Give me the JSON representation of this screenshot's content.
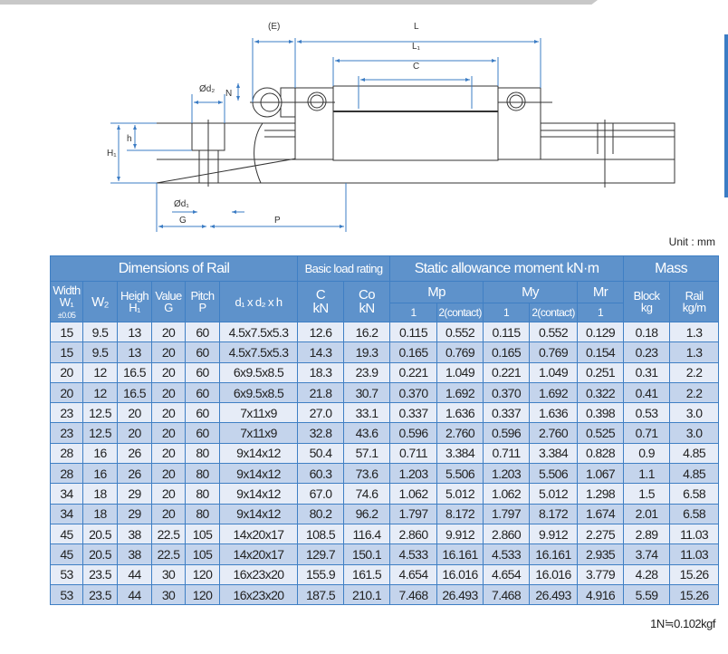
{
  "drawing": {
    "labels": {
      "E": "(E)",
      "L": "L",
      "L1": "L₁",
      "C": "C",
      "N": "N",
      "d2": "Ød₂",
      "d1": "Ød₁",
      "h": "h",
      "H1": "H₁",
      "G": "G",
      "P": "P"
    }
  },
  "unit": "Unit : mm",
  "table": {
    "groups": {
      "rail": "Dimensions of Rail",
      "load": "Basic load rating",
      "moment": "Static allowance moment kN·m",
      "mass": "Mass"
    },
    "cols": {
      "width": "Width",
      "w1": "W₁",
      "tol": "±0.05",
      "w2": "W₂",
      "height": "Heigh",
      "h1": "H₁",
      "value": "Value",
      "g": "G",
      "pitch": "Pitch",
      "p": "P",
      "dims": "d₁ x d₂ x h",
      "c": "C",
      "c_unit": "kN",
      "co": "Co",
      "co_unit": "kN",
      "mp": "Mp",
      "my": "My",
      "mr": "Mr",
      "one": "1",
      "two": "2(contact)",
      "block": "Block",
      "block_unit": "kg",
      "rail": "Rail",
      "rail_unit": "kg/m"
    },
    "rows": [
      [
        "15",
        "9.5",
        "13",
        "20",
        "60",
        "4.5x7.5x5.3",
        "12.6",
        "16.2",
        "0.115",
        "0.552",
        "0.115",
        "0.552",
        "0.129",
        "0.18",
        "1.3"
      ],
      [
        "15",
        "9.5",
        "13",
        "20",
        "60",
        "4.5x7.5x5.3",
        "14.3",
        "19.3",
        "0.165",
        "0.769",
        "0.165",
        "0.769",
        "0.154",
        "0.23",
        "1.3"
      ],
      [
        "20",
        "12",
        "16.5",
        "20",
        "60",
        "6x9.5x8.5",
        "18.3",
        "23.9",
        "0.221",
        "1.049",
        "0.221",
        "1.049",
        "0.251",
        "0.31",
        "2.2"
      ],
      [
        "20",
        "12",
        "16.5",
        "20",
        "60",
        "6x9.5x8.5",
        "21.8",
        "30.7",
        "0.370",
        "1.692",
        "0.370",
        "1.692",
        "0.322",
        "0.41",
        "2.2"
      ],
      [
        "23",
        "12.5",
        "20",
        "20",
        "60",
        "7x11x9",
        "27.0",
        "33.1",
        "0.337",
        "1.636",
        "0.337",
        "1.636",
        "0.398",
        "0.53",
        "3.0"
      ],
      [
        "23",
        "12.5",
        "20",
        "20",
        "60",
        "7x11x9",
        "32.8",
        "43.6",
        "0.596",
        "2.760",
        "0.596",
        "2.760",
        "0.525",
        "0.71",
        "3.0"
      ],
      [
        "28",
        "16",
        "26",
        "20",
        "80",
        "9x14x12",
        "50.4",
        "57.1",
        "0.711",
        "3.384",
        "0.711",
        "3.384",
        "0.828",
        "0.9",
        "4.85"
      ],
      [
        "28",
        "16",
        "26",
        "20",
        "80",
        "9x14x12",
        "60.3",
        "73.6",
        "1.203",
        "5.506",
        "1.203",
        "5.506",
        "1.067",
        "1.1",
        "4.85"
      ],
      [
        "34",
        "18",
        "29",
        "20",
        "80",
        "9x14x12",
        "67.0",
        "74.6",
        "1.062",
        "5.012",
        "1.062",
        "5.012",
        "1.298",
        "1.5",
        "6.58"
      ],
      [
        "34",
        "18",
        "29",
        "20",
        "80",
        "9x14x12",
        "80.2",
        "96.2",
        "1.797",
        "8.172",
        "1.797",
        "8.172",
        "1.674",
        "2.01",
        "6.58"
      ],
      [
        "45",
        "20.5",
        "38",
        "22.5",
        "105",
        "14x20x17",
        "108.5",
        "116.4",
        "2.860",
        "9.912",
        "2.860",
        "9.912",
        "2.275",
        "2.89",
        "11.03"
      ],
      [
        "45",
        "20.5",
        "38",
        "22.5",
        "105",
        "14x20x17",
        "129.7",
        "150.1",
        "4.533",
        "16.161",
        "4.533",
        "16.161",
        "2.935",
        "3.74",
        "11.03"
      ],
      [
        "53",
        "23.5",
        "44",
        "30",
        "120",
        "16x23x20",
        "155.9",
        "161.5",
        "4.654",
        "16.016",
        "4.654",
        "16.016",
        "3.779",
        "4.28",
        "15.26"
      ],
      [
        "53",
        "23.5",
        "44",
        "30",
        "120",
        "16x23x20",
        "187.5",
        "210.1",
        "7.468",
        "26.493",
        "7.468",
        "26.493",
        "4.916",
        "5.59",
        "15.26"
      ]
    ]
  },
  "note": "1N≒0.102kgf"
}
